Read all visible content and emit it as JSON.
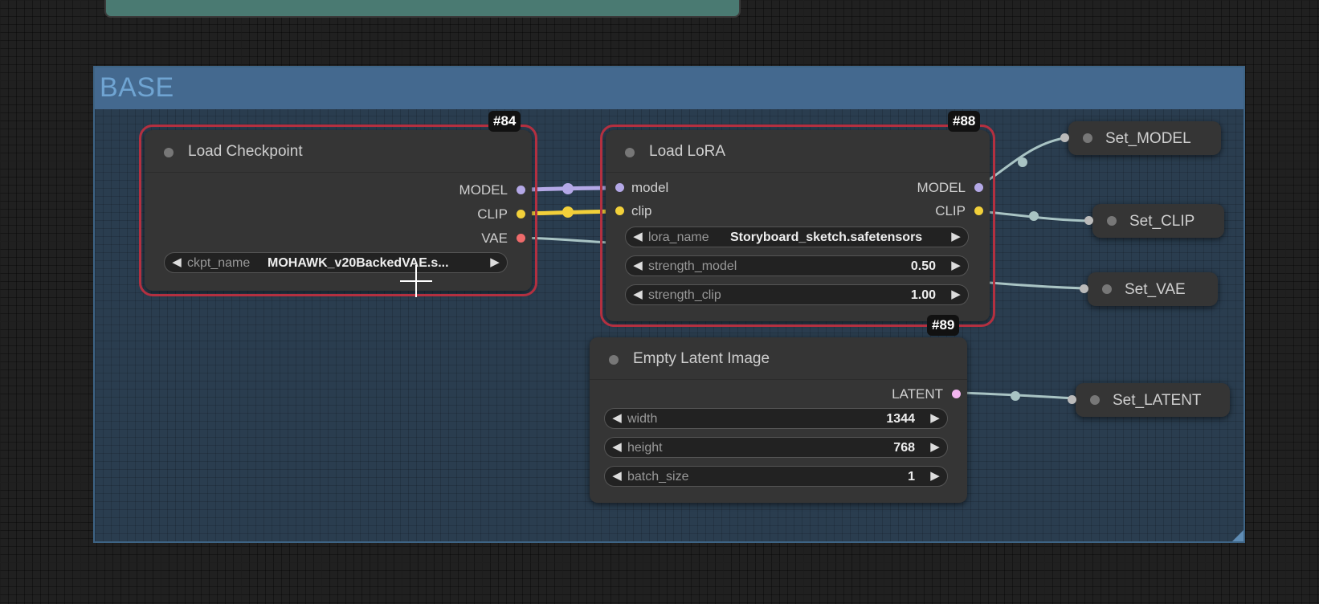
{
  "group": {
    "title": "BASE"
  },
  "nodes": {
    "load_checkpoint": {
      "id": "#84",
      "title": "Load Checkpoint",
      "outputs": [
        "MODEL",
        "CLIP",
        "VAE"
      ],
      "widget": {
        "name": "ckpt_name",
        "value": "MOHAWK_v20BackedVAE.s..."
      }
    },
    "load_lora": {
      "id": "#88",
      "title": "Load LoRA",
      "inputs": [
        "model",
        "clip"
      ],
      "outputs": [
        "MODEL",
        "CLIP"
      ],
      "widgets": [
        {
          "name": "lora_name",
          "value": "Storyboard_sketch.safetensors"
        },
        {
          "name": "strength_model",
          "value": "0.50"
        },
        {
          "name": "strength_clip",
          "value": "1.00"
        }
      ]
    },
    "empty_latent": {
      "id": "#89",
      "title": "Empty Latent Image",
      "outputs": [
        "LATENT"
      ],
      "widgets": [
        {
          "name": "width",
          "value": "1344"
        },
        {
          "name": "height",
          "value": "768"
        },
        {
          "name": "batch_size",
          "value": "1"
        }
      ]
    },
    "set_model": {
      "title": "Set_MODEL"
    },
    "set_clip": {
      "title": "Set_CLIP"
    },
    "set_vae": {
      "title": "Set_VAE"
    },
    "set_latent": {
      "title": "Set_LATENT"
    }
  },
  "colors": {
    "model": "#b4a8e6",
    "clip": "#f2d03a",
    "vae": "#ef6b6b",
    "latent": "#f3b5f0",
    "link_default": "#a9c4c4",
    "selected_outline": "#b33040",
    "group_header": "#44698f"
  }
}
